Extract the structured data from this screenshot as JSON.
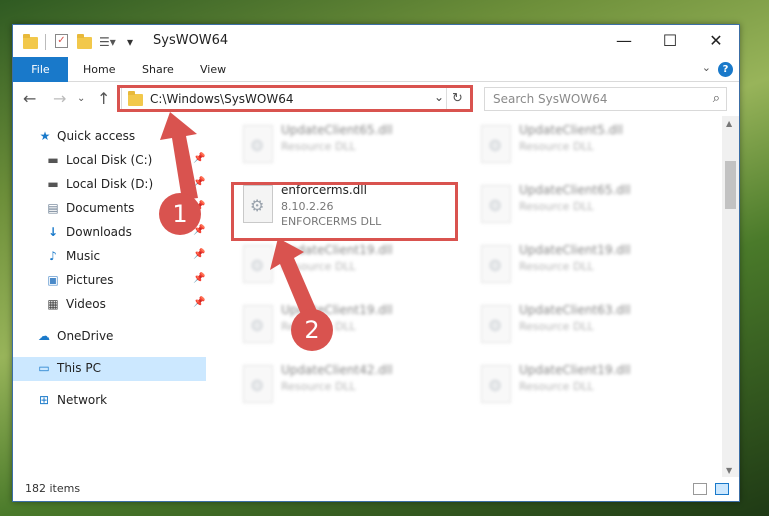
{
  "window": {
    "title": "SysWOW64"
  },
  "ribbon": {
    "file": "File",
    "home": "Home",
    "share": "Share",
    "view": "View"
  },
  "address": {
    "path": "C:\\Windows\\SysWOW64"
  },
  "search": {
    "placeholder": "Search SysWOW64"
  },
  "sidebar": {
    "quick_access": "Quick access",
    "items": [
      {
        "label": "Local Disk (C:)",
        "icon": "drive-icon"
      },
      {
        "label": "Local Disk (D:)",
        "icon": "drive-icon"
      },
      {
        "label": "Documents",
        "icon": "documents-icon"
      },
      {
        "label": "Downloads",
        "icon": "download-icon"
      },
      {
        "label": "Music",
        "icon": "music-icon"
      },
      {
        "label": "Pictures",
        "icon": "pictures-icon"
      },
      {
        "label": "Videos",
        "icon": "videos-icon"
      }
    ],
    "onedrive": "OneDrive",
    "this_pc": "This PC",
    "network": "Network"
  },
  "files": [
    {
      "name": "UpdateClient65.dll",
      "type": "Resource DLL"
    },
    {
      "name": "UpdateClient5.dll",
      "type": "Resource DLL"
    },
    {
      "name": "enforcerms.dll",
      "version": "8.10.2.26",
      "type": "ENFORCERMS DLL"
    },
    {
      "name": "UpdateClient65.dll",
      "type": "Resource DLL"
    },
    {
      "name": "UpdateClient19.dll",
      "type": "Resource DLL"
    },
    {
      "name": "UpdateClient19.dll",
      "type": "Resource DLL"
    },
    {
      "name": "UpdateClient19.dll",
      "type": "Resource DLL"
    },
    {
      "name": "UpdateClient63.dll",
      "type": "Resource DLL"
    },
    {
      "name": "UpdateClient42.dll",
      "type": "Resource DLL"
    },
    {
      "name": "UpdateClient19.dll",
      "type": "Resource DLL"
    }
  ],
  "status": {
    "count": "182 items"
  },
  "annotations": {
    "step1": "1",
    "step2": "2",
    "color": "#d9534f"
  }
}
